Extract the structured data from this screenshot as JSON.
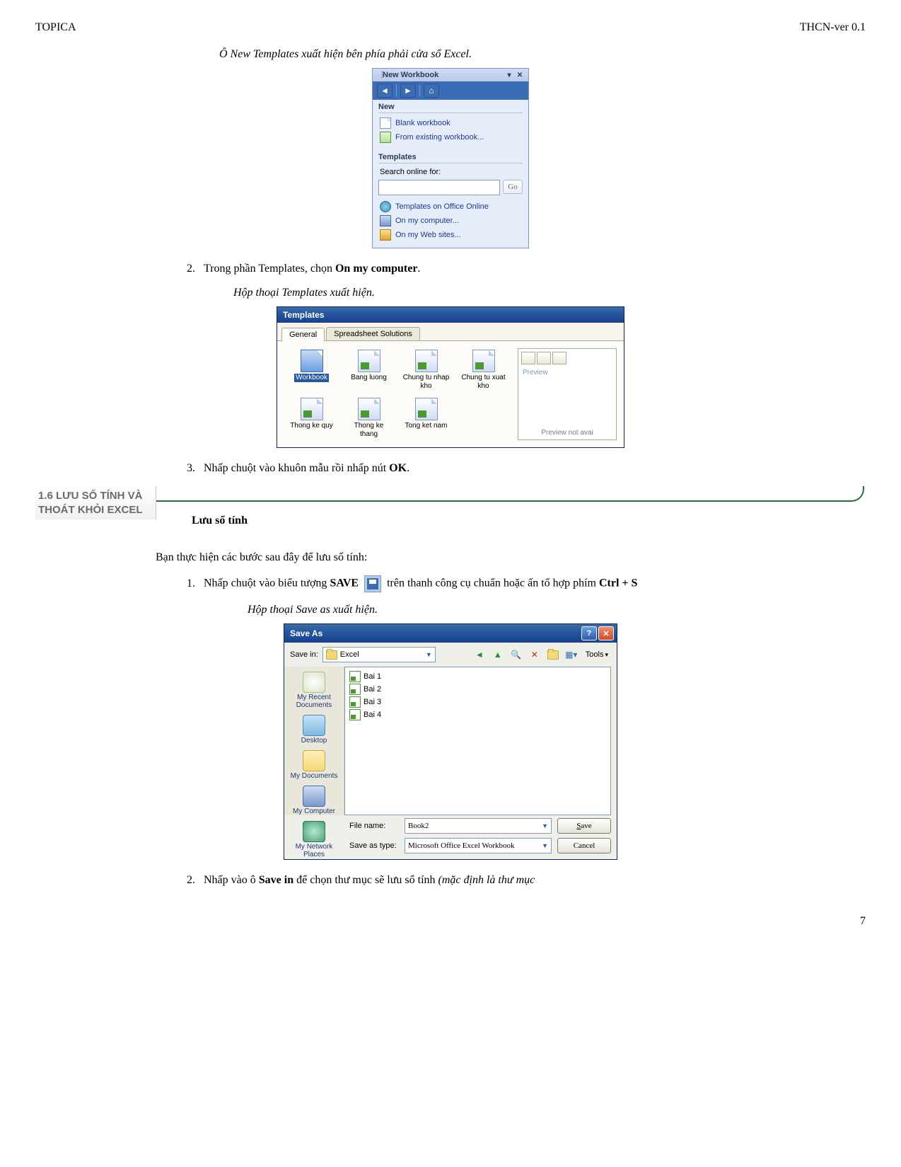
{
  "header": {
    "left": "TOPICA",
    "right": "THCN-ver 0.1"
  },
  "caption1": "Ô New Templates xuất hiện bên phía phải cửa sổ Excel.",
  "nw": {
    "title": "New Workbook",
    "new_label": "New",
    "blank": "Blank workbook",
    "from_existing": "From existing workbook...",
    "templates_label": "Templates",
    "search_label": "Search online for:",
    "go": "Go",
    "office_online": "Templates on Office Online",
    "on_computer": "On my computer...",
    "on_web": "On my Web sites..."
  },
  "step2_pre": "Trong phần Templates, chọn ",
  "step2_bold": "On my computer",
  "step2_post": ".",
  "caption2": "Hộp thoại Templates xuất hiện.",
  "tpl": {
    "title": "Templates",
    "tab_general": "General",
    "tab_ss": "Spreadsheet Solutions",
    "items": [
      {
        "label": "Workbook",
        "wb": true,
        "selected": true
      },
      {
        "label": "Bang luong"
      },
      {
        "label": "Chung tu nhap kho"
      },
      {
        "label": "Chung tu xuat kho"
      },
      {
        "label": "Thong ke quy"
      },
      {
        "label": "Thong ke thang"
      },
      {
        "label": "Tong ket nam"
      }
    ],
    "preview_label": "Preview",
    "preview_not_avail": "Preview not avai"
  },
  "step3_pre": "Nhấp chuột vào khuôn mẫu rồi nhấp nút ",
  "step3_bold": "OK",
  "step3_post": ".",
  "section": {
    "label": "1.6 LƯU SỔ TÍNH VÀ THOÁT KHỎI EXCEL",
    "subtitle": "Lưu sổ tính"
  },
  "intro": "Bạn thực hiện các bước sau đây để lưu sổ tính:",
  "save_step1_p1": "Nhấp chuột vào biểu tượng ",
  "save_step1_b1": "SAVE",
  "save_step1_p2": " trên thanh công cụ chuẩn hoặc ấn tổ hợp phím ",
  "save_step1_b2": "Ctrl + S",
  "caption3": "Hộp thoại Save as xuất hiện.",
  "sa": {
    "title": "Save As",
    "savein_label": "Save in:",
    "savein_value": "Excel",
    "tools": "Tools",
    "places": {
      "recent": "My Recent Documents",
      "desktop": "Desktop",
      "docs": "My Documents",
      "comp": "My Computer",
      "net": "My Network Places"
    },
    "files": [
      "Bai 1",
      "Bai 2",
      "Bai 3",
      "Bai 4"
    ],
    "filename_label": "File name:",
    "filename_value": "Book2",
    "saveas_label": "Save as type:",
    "saveas_value": "Microsoft Office Excel Workbook",
    "save_btn": "Save",
    "cancel_btn": "Cancel"
  },
  "save_step2_p1": "Nhấp vào ô ",
  "save_step2_b1": "Save in",
  "save_step2_p2": " để chọn thư mục sẽ lưu sổ tính ",
  "save_step2_i1": "(mặc định là thư mục",
  "page_number": "7"
}
